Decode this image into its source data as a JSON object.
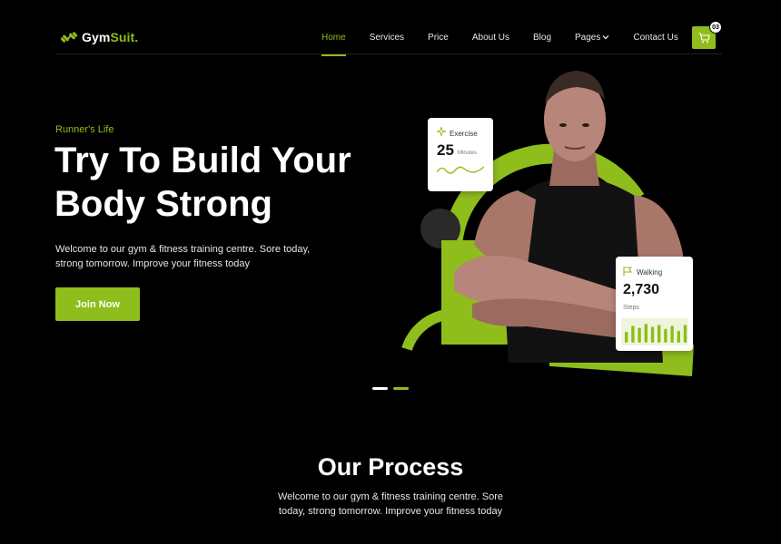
{
  "brand": {
    "name_part1": "Gym",
    "name_part2": "Suit."
  },
  "nav": {
    "items": [
      {
        "label": "Home",
        "active": true
      },
      {
        "label": "Services",
        "active": false
      },
      {
        "label": "Price",
        "active": false
      },
      {
        "label": "About Us",
        "active": false
      },
      {
        "label": "Blog",
        "active": false
      },
      {
        "label": "Pages",
        "active": false,
        "has_dropdown": true
      },
      {
        "label": "Contact Us",
        "active": false
      }
    ],
    "cart_count": "03",
    "cart_icon": "cart-icon",
    "dropdown_icon": "chevron-down-icon"
  },
  "hero": {
    "eyebrow": "Runner's Life",
    "title_line1": "Try To Build Your",
    "title_line2": "Body Strong",
    "description": "Welcome to our gym & fitness training centre. Sore today, strong tomorrow. Improve your fitness today",
    "cta_label": "Join Now",
    "slider_dots": 2,
    "active_slide": 2
  },
  "exercise_card": {
    "label": "Exercise",
    "value": "25",
    "unit": "Minutes",
    "icon": "sparkle-icon"
  },
  "walking_card": {
    "label": "Walking",
    "value": "2,730",
    "unit": "Steps",
    "icon": "flag-icon",
    "bar_levels": [
      0.55,
      0.85,
      0.75,
      0.95,
      0.8,
      0.9,
      0.7,
      0.85,
      0.6,
      0.9
    ]
  },
  "process": {
    "title": "Our Process",
    "description": "Welcome to our gym & fitness training centre. Sore today, strong tomorrow. Improve your fitness today"
  },
  "colors": {
    "accent": "#8fbd1c",
    "background": "#000000",
    "text": "#ffffff"
  }
}
